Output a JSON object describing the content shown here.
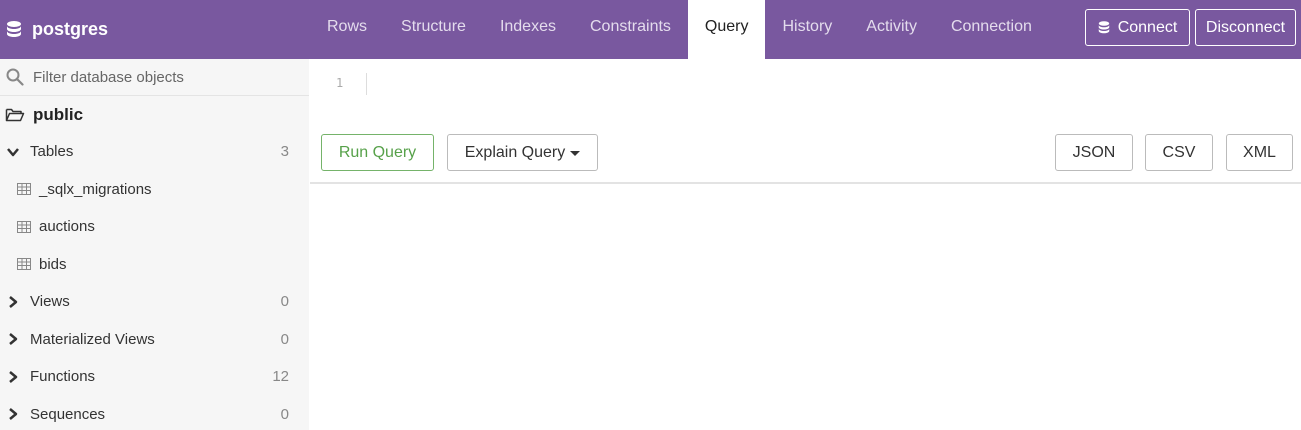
{
  "app": {
    "title": "postgres"
  },
  "tabs": [
    {
      "label": "Rows",
      "active": false
    },
    {
      "label": "Structure",
      "active": false
    },
    {
      "label": "Indexes",
      "active": false
    },
    {
      "label": "Constraints",
      "active": false
    },
    {
      "label": "Query",
      "active": true
    },
    {
      "label": "History",
      "active": false
    },
    {
      "label": "Activity",
      "active": false
    },
    {
      "label": "Connection",
      "active": false
    }
  ],
  "header_buttons": {
    "connect": "Connect",
    "disconnect": "Disconnect"
  },
  "sidebar": {
    "filter_placeholder": "Filter database objects",
    "schema": "public",
    "tables_group": {
      "label": "Tables",
      "count": "3",
      "expanded": true
    },
    "tables": [
      "_sqlx_migrations",
      "auctions",
      "bids"
    ],
    "groups": [
      {
        "label": "Views",
        "count": "0"
      },
      {
        "label": "Materialized Views",
        "count": "0"
      },
      {
        "label": "Functions",
        "count": "12"
      },
      {
        "label": "Sequences",
        "count": "0"
      }
    ]
  },
  "editor": {
    "line_number": "1",
    "content": ""
  },
  "toolbar": {
    "run_query": "Run Query",
    "explain_query": "Explain Query",
    "json": "JSON",
    "csv": "CSV",
    "xml": "XML"
  },
  "colors": {
    "header_bg": "#79589f",
    "sidebar_bg": "#f6f6f6",
    "run_green": "#57a14a"
  }
}
